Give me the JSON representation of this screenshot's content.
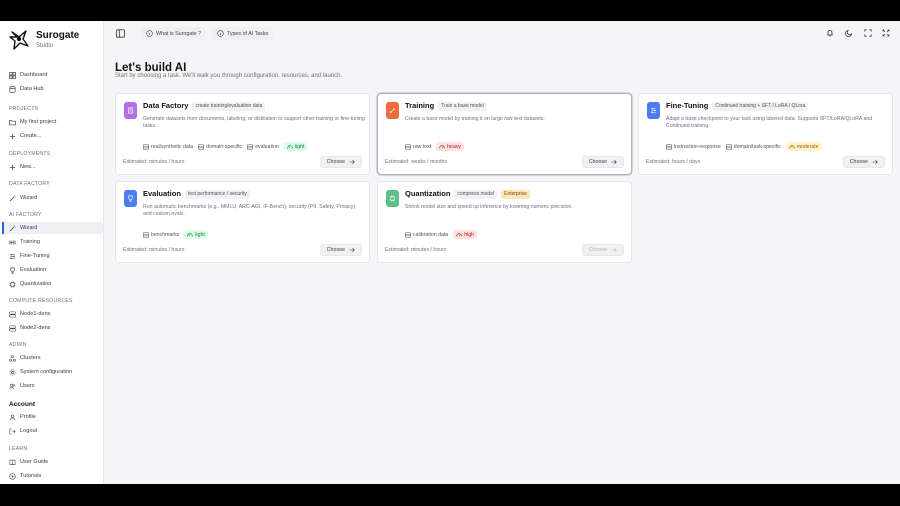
{
  "brand": {
    "name": "Surogate",
    "sub": "Studio"
  },
  "sidebar": {
    "top": [
      {
        "label": "Dashboard",
        "icon": "dashboard-icon"
      },
      {
        "label": "Data Hub",
        "icon": "database-icon"
      }
    ],
    "sections": [
      {
        "title": "PROJECTS",
        "items": [
          {
            "label": "My first project",
            "icon": "folder-icon"
          },
          {
            "label": "Create...",
            "icon": "plus-icon"
          }
        ]
      },
      {
        "title": "DEPLOYMENTS",
        "items": [
          {
            "label": "New...",
            "icon": "plus-icon"
          }
        ]
      },
      {
        "title": "DATA FACTORY",
        "items": [
          {
            "label": "Wizard",
            "icon": "wand-icon"
          }
        ]
      },
      {
        "title": "AI FACTORY",
        "items": [
          {
            "label": "Wizard",
            "icon": "wand-icon"
          },
          {
            "label": "Training",
            "icon": "dumbbell-icon"
          },
          {
            "label": "Fine-Tuning",
            "icon": "sliders-icon"
          },
          {
            "label": "Evaluation",
            "icon": "trophy-icon"
          },
          {
            "label": "Quantization",
            "icon": "chip-icon"
          }
        ]
      },
      {
        "title": "COMPUTE RESOURCES",
        "items": [
          {
            "label": "Node1-dens",
            "icon": "server-icon"
          },
          {
            "label": "Node2-dens",
            "icon": "server-icon"
          }
        ]
      },
      {
        "title": "ADMIN",
        "items": [
          {
            "label": "Clusters",
            "icon": "cluster-icon"
          },
          {
            "label": "System configuration",
            "icon": "gear-icon"
          },
          {
            "label": "Users",
            "icon": "users-icon"
          }
        ]
      },
      {
        "title": "Account",
        "items": [
          {
            "label": "Profile",
            "icon": "user-icon"
          },
          {
            "label": "Logout",
            "icon": "logout-icon"
          }
        ]
      },
      {
        "title": "LEARN",
        "items": [
          {
            "label": "User Guide",
            "icon": "book-icon"
          },
          {
            "label": "Tutorials",
            "icon": "play-icon"
          }
        ]
      }
    ]
  },
  "topbar": {
    "pill1": "What is Surogate ?",
    "pill2": "Types of AI Tasks"
  },
  "page": {
    "title": "Let's build AI",
    "subtitle": "Start by choosing a task. We'll walk you through configuration, resources, and launch."
  },
  "cards": [
    {
      "title": "Data Factory",
      "tag": "create training/evaluation data",
      "desc": "Generate datasets from documents, labeling, or distillation to support other training or fine-tuning tasks.",
      "chips": [
        "real/synthetic data",
        "domain-specific",
        "evaluation"
      ],
      "badge": "light",
      "estimate": "Estimated: minutes / hours",
      "choose": "Choose",
      "accent": "#a855f7"
    },
    {
      "title": "Training",
      "tag": "Train a base model",
      "desc": "Create a base model by training it on large raw text datasets.",
      "chips": [
        "raw text"
      ],
      "badge": "heavy",
      "estimate": "Estimated: weeks / months",
      "choose": "Choose",
      "accent": "#f97316"
    },
    {
      "title": "Fine-Tuning",
      "tag": "Continued training + SFT / LoRA / QLora",
      "desc": "Adapt a base checkpoint to your task using labeled data. Supports SFT/LoRA/QLoRA and Continued training.",
      "chips": [
        "instruction-response",
        "domain/task-specific"
      ],
      "badge": "moderate",
      "estimate": "Estimated: hours / days",
      "choose": "Choose",
      "accent": "#3b82f6"
    },
    {
      "title": "Evaluation",
      "tag": "test performance / security",
      "desc": "Run automatic benchmarks (e.g., MMLU, ARC-AGI, IF-Bench), security (PII, Safety, Privacy) and custom evals.",
      "chips": [
        "benchmarks"
      ],
      "badge": "light",
      "estimate": "Estimated: minutes / hours",
      "choose": "Choose",
      "accent": "#3b82f6"
    },
    {
      "title": "Quantization",
      "tag": "compress model",
      "tag2": "Enterprise",
      "desc": "Shrink model size and speed up inference by lowering numeric precision.",
      "chips": [
        "calibration data"
      ],
      "badge": "high",
      "estimate": "Estimated: minutes / hours",
      "choose": "Choose",
      "accent": "#22c55e"
    }
  ]
}
